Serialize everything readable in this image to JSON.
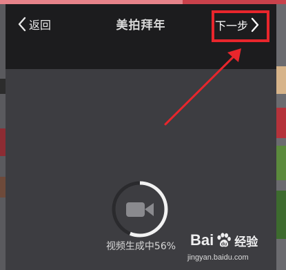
{
  "header": {
    "back_label": "返回",
    "title": "美拍拜年",
    "next_label": "下一步"
  },
  "progress": {
    "percent": 56,
    "label": "视频生成中56%"
  },
  "annotation": {
    "highlight_color": "#e8262c"
  },
  "watermark": {
    "brand_left": "Bai",
    "brand_right": "经验",
    "url": "jingyan.baidu.com"
  },
  "icons": [
    "chevron-left-icon",
    "chevron-right-icon",
    "video-camera-icon",
    "baidu-paw-icon"
  ]
}
